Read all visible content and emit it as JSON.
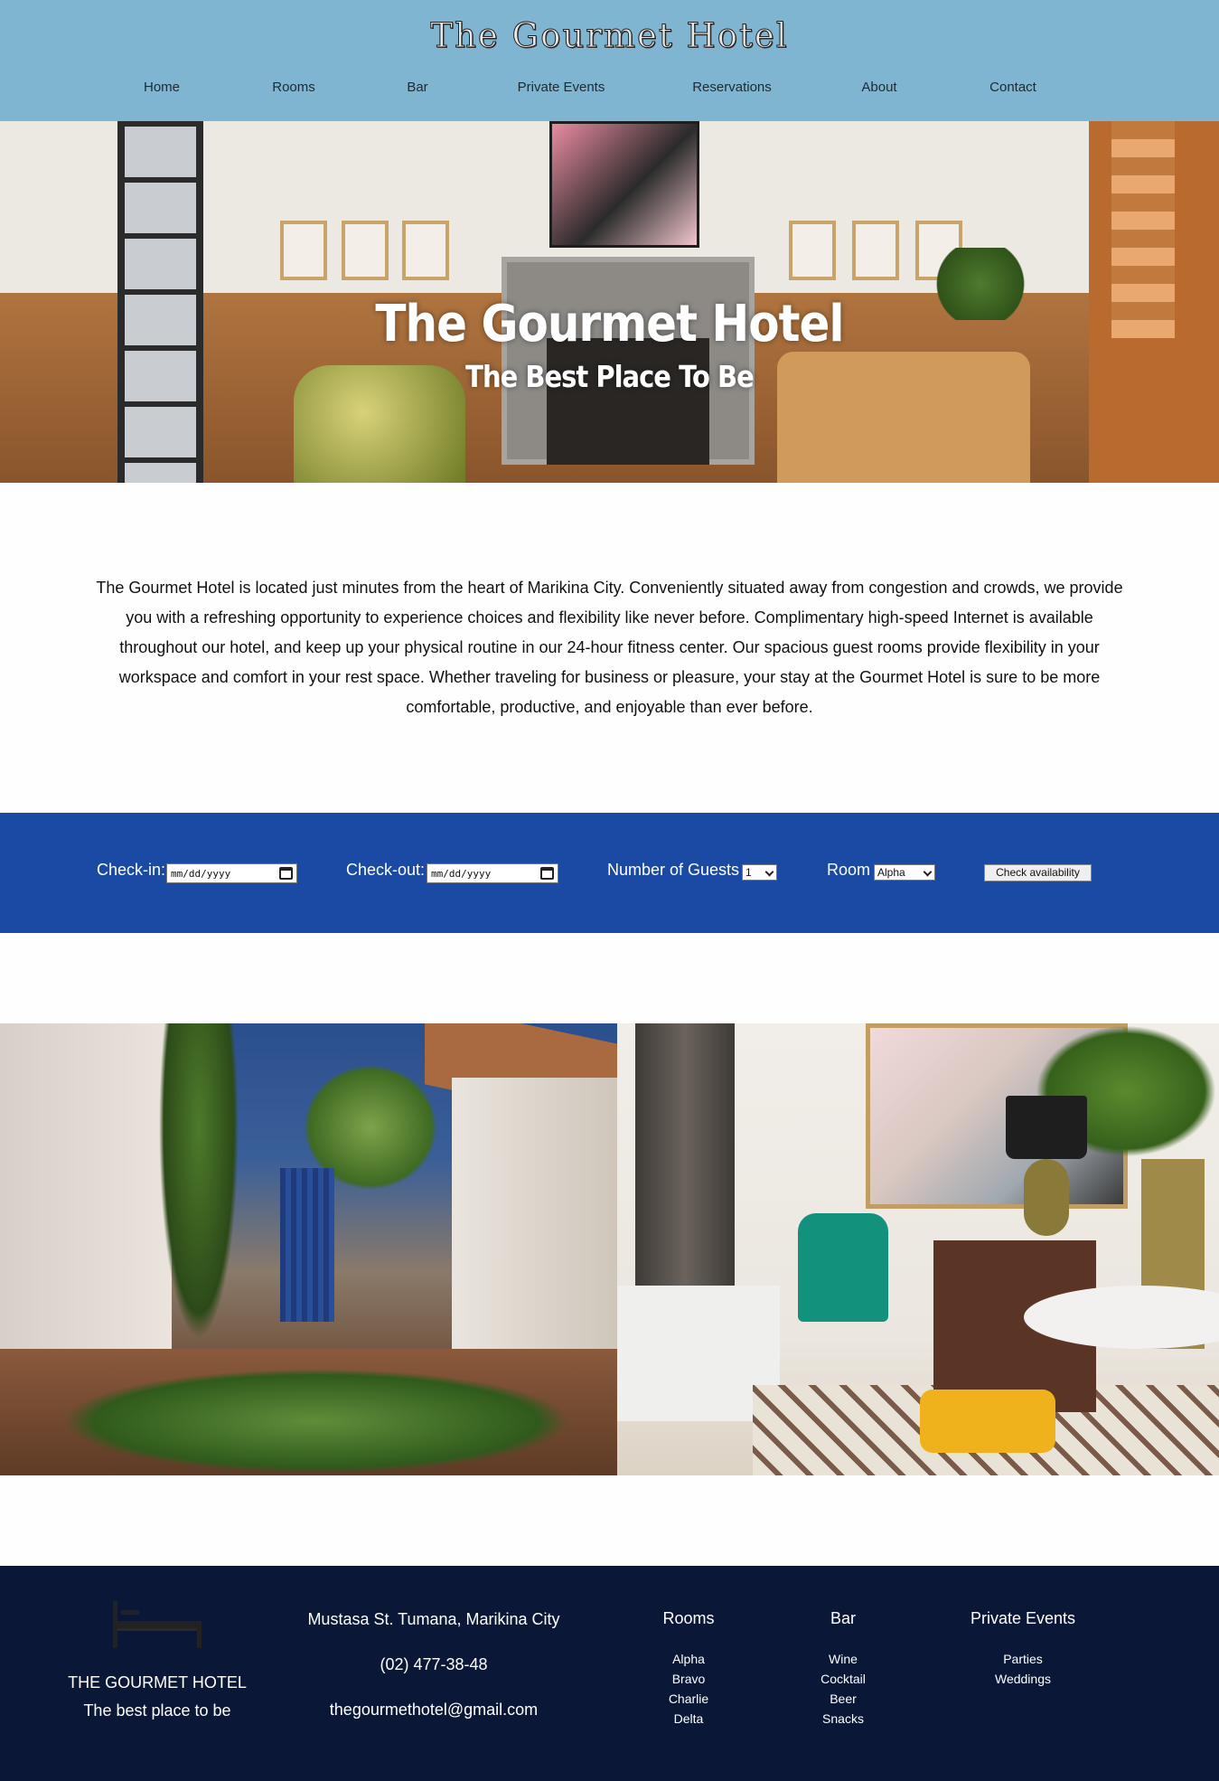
{
  "header": {
    "site_title": "The Gourmet Hotel",
    "nav": [
      "Home",
      "Rooms",
      "Bar",
      "Private Events",
      "Reservations",
      "About",
      "Contact"
    ]
  },
  "hero": {
    "title": "The Gourmet Hotel",
    "subtitle": "The Best Place To Be"
  },
  "intro": {
    "text": "The Gourmet Hotel is located just minutes from the heart of Marikina City. Conveniently situated away from congestion and crowds, we provide you with a refreshing opportunity to experience choices and flexibility like never before. Complimentary high-speed Internet is available throughout our hotel, and keep up your physical routine in our 24-hour fitness center. Our spacious guest rooms provide flexibility in your workspace and comfort in your rest space. Whether traveling for business or pleasure, your stay at the Gourmet Hotel is sure to be more comfortable, productive, and enjoyable than ever before."
  },
  "booking": {
    "checkin_label": "Check-in:",
    "checkin_value": "mm/dd/yyyy",
    "checkout_label": "Check-out:",
    "checkout_value": "mm/dd/yyyy",
    "guests_label": "Number of Guests",
    "guests_value": "1",
    "room_label": "Room",
    "room_value": "Alpha",
    "button_label": "Check availability"
  },
  "footer": {
    "brand_name": "THE GOURMET HOTEL",
    "tagline": "The best place to be",
    "address": "Mustasa St. Tumana, Marikina City",
    "phone": "(02) 477-38-48",
    "email": "thegourmethotel@gmail.com",
    "columns": [
      {
        "heading": "Rooms",
        "items": [
          "Alpha",
          "Bravo",
          "Charlie",
          "Delta"
        ]
      },
      {
        "heading": "Bar",
        "items": [
          "Wine",
          "Cocktail",
          "Beer",
          "Snacks"
        ]
      },
      {
        "heading": "Private Events",
        "items": [
          "Parties",
          "Weddings"
        ]
      }
    ]
  },
  "colors": {
    "header_bg": "#7fb5d0",
    "booking_bg": "#1a4aa3",
    "footer_bg": "#0b1736"
  }
}
